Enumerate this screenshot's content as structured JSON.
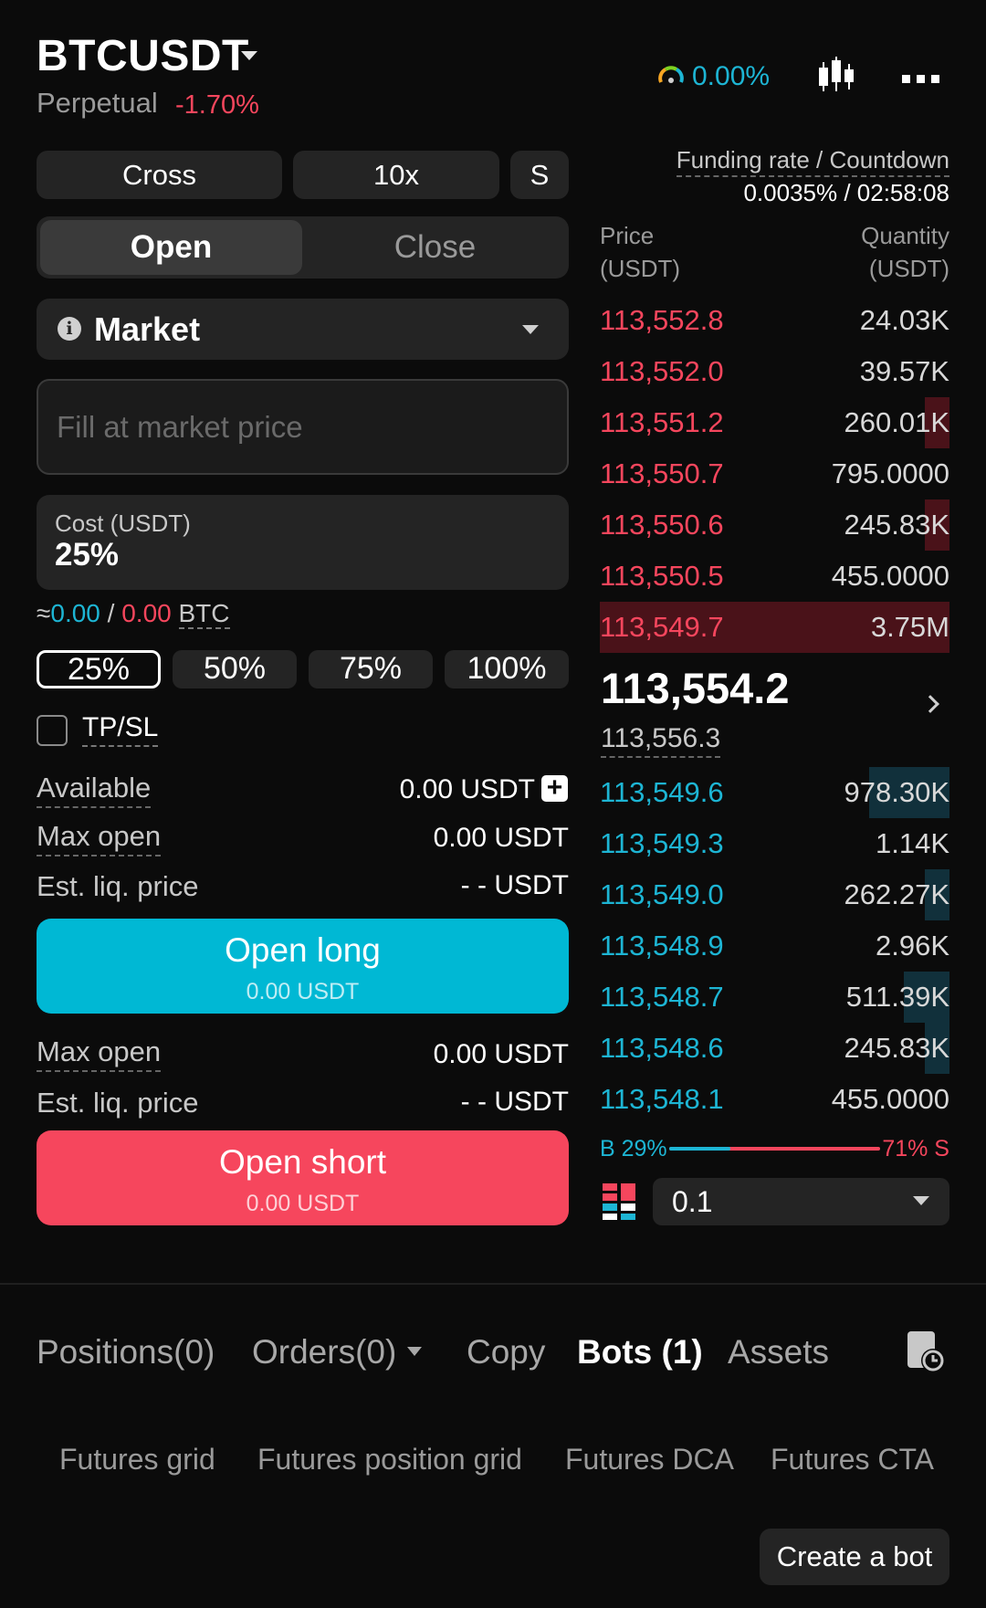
{
  "header": {
    "symbol": "BTCUSDT",
    "contract_type": "Perpetual",
    "change": "-1.70%",
    "rate_indicator": "0.00%",
    "icons": [
      "chevron-down-icon",
      "gauge-icon",
      "candlestick-chart-icon",
      "more-icon"
    ]
  },
  "trade_settings": {
    "margin_mode": "Cross",
    "leverage": "10x",
    "position_mode": "S"
  },
  "side_tabs": {
    "open": "Open",
    "close": "Close",
    "active": "open"
  },
  "order_type": {
    "label": "Market",
    "icon": "info-icon"
  },
  "price_input": {
    "placeholder": "Fill at market price"
  },
  "cost": {
    "label": "Cost (USDT)",
    "value": "25%"
  },
  "approx": {
    "prefix": "≈",
    "long_value": "0.00",
    "separator": " / ",
    "short_value": "0.00",
    "unit": "BTC"
  },
  "percent_options": [
    "25%",
    "50%",
    "75%",
    "100%"
  ],
  "percent_selected": "25%",
  "tpsl": {
    "label": "TP/SL",
    "checked": false
  },
  "long_info": {
    "available_label": "Available",
    "available_value": "0.00 USDT",
    "max_open_label": "Max open",
    "max_open_value": "0.00 USDT",
    "liq_label": "Est. liq. price",
    "liq_value": "- - USDT"
  },
  "open_long": {
    "title": "Open long",
    "subtitle": "0.00 USDT"
  },
  "short_info": {
    "max_open_label": "Max open",
    "max_open_value": "0.00 USDT",
    "liq_label": "Est. liq. price",
    "liq_value": "- - USDT"
  },
  "open_short": {
    "title": "Open short",
    "subtitle": "0.00 USDT"
  },
  "funding": {
    "label": "Funding rate / Countdown",
    "value": "0.0035% / 02:58:08"
  },
  "orderbook": {
    "price_header": "Price",
    "price_unit": "(USDT)",
    "qty_header": "Quantity",
    "qty_unit": "(USDT)",
    "asks": [
      {
        "price": "113,552.8",
        "qty": "24.03K",
        "depth": 0.0
      },
      {
        "price": "113,552.0",
        "qty": "39.57K",
        "depth": 0.0
      },
      {
        "price": "113,551.2",
        "qty": "260.01K",
        "depth": 0.07
      },
      {
        "price": "113,550.7",
        "qty": "795.0000",
        "depth": 0.0
      },
      {
        "price": "113,550.6",
        "qty": "245.83K",
        "depth": 0.07
      },
      {
        "price": "113,550.5",
        "qty": "455.0000",
        "depth": 0.0
      },
      {
        "price": "113,549.7",
        "qty": "3.75M",
        "depth": 1.0
      }
    ],
    "last_price": "113,554.2",
    "mark_price": "113,556.3",
    "bids": [
      {
        "price": "113,549.6",
        "qty": "978.30K",
        "depth": 0.23
      },
      {
        "price": "113,549.3",
        "qty": "1.14K",
        "depth": 0.0
      },
      {
        "price": "113,549.0",
        "qty": "262.27K",
        "depth": 0.07
      },
      {
        "price": "113,548.9",
        "qty": "2.96K",
        "depth": 0.0
      },
      {
        "price": "113,548.7",
        "qty": "511.39K",
        "depth": 0.13
      },
      {
        "price": "113,548.6",
        "qty": "245.83K",
        "depth": 0.07
      },
      {
        "price": "113,548.1",
        "qty": "455.0000",
        "depth": 0.0
      }
    ],
    "buy_ratio": "B 29%",
    "sell_ratio": "71% S",
    "buy_fraction": 0.29,
    "step": "0.1"
  },
  "bottom_tabs": [
    "Positions(0)",
    "Orders(0)",
    "Copy",
    "Bots (1)",
    "Assets"
  ],
  "bottom_tab_active": "Bots (1)",
  "bot_types": [
    "Futures grid",
    "Futures position grid",
    "Futures DCA",
    "Futures CTA"
  ],
  "create_bot": "Create a bot",
  "colors": {
    "long": "#00b8d4",
    "short": "#f6465d",
    "bg": "#0b0b0b",
    "panel": "#242424"
  }
}
